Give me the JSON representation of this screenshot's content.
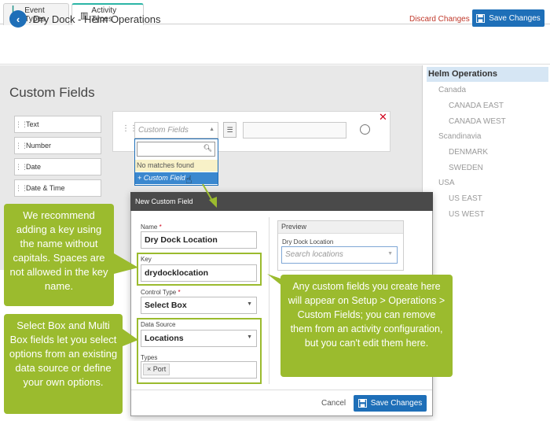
{
  "tabs": [
    {
      "label": "Event Types",
      "icon": "event-types-icon"
    },
    {
      "label": "Activity Types",
      "icon": "activity-types-icon"
    }
  ],
  "header": {
    "title": "Dry Dock - Helm Operations",
    "discard": "Discard Changes",
    "save": "Save Changes"
  },
  "main": {
    "title": "Custom Fields",
    "field_types": [
      "Text",
      "Number",
      "Date",
      "Date & Time"
    ]
  },
  "row": {
    "select_placeholder": "Custom Fields",
    "dropdown": {
      "no_matches": "No matches found",
      "add": "+ Custom Field"
    }
  },
  "right_panel": {
    "title": "Helm Operations",
    "groups": [
      {
        "name": "Canada",
        "items": [
          "CANADA EAST",
          "CANADA WEST"
        ]
      },
      {
        "name": "Scandinavia",
        "items": [
          "DENMARK",
          "SWEDEN"
        ]
      },
      {
        "name": "USA",
        "items": [
          "US EAST",
          "US WEST"
        ]
      }
    ]
  },
  "modal": {
    "title": "New Custom Field",
    "name_label": "Name",
    "name_value": "Dry Dock Location",
    "key_label": "Key",
    "key_value": "drydocklocation",
    "control_label": "Control Type",
    "control_value": "Select Box",
    "datasource_label": "Data Source",
    "datasource_value": "Locations",
    "types_label": "Types",
    "types_chip": "Port",
    "preview_title": "Preview",
    "preview_field_label": "Dry Dock Location",
    "preview_placeholder": "Search locations",
    "cancel": "Cancel",
    "save": "Save Changes"
  },
  "callouts": {
    "key": "We recommend adding a key using the name without capitals. Spaces are not allowed in the key name.",
    "select": "Select Box and Multi Box fields let you select options from an existing data source or define your own options.",
    "custom": "Any custom fields you create here will appear on Setup > Operations > Custom Fields; you can remove them from an activity configuration, but you can't edit them here."
  },
  "colors": {
    "accent": "#1e6fb8",
    "callout": "#9bbb2e",
    "danger": "#d0021b"
  }
}
